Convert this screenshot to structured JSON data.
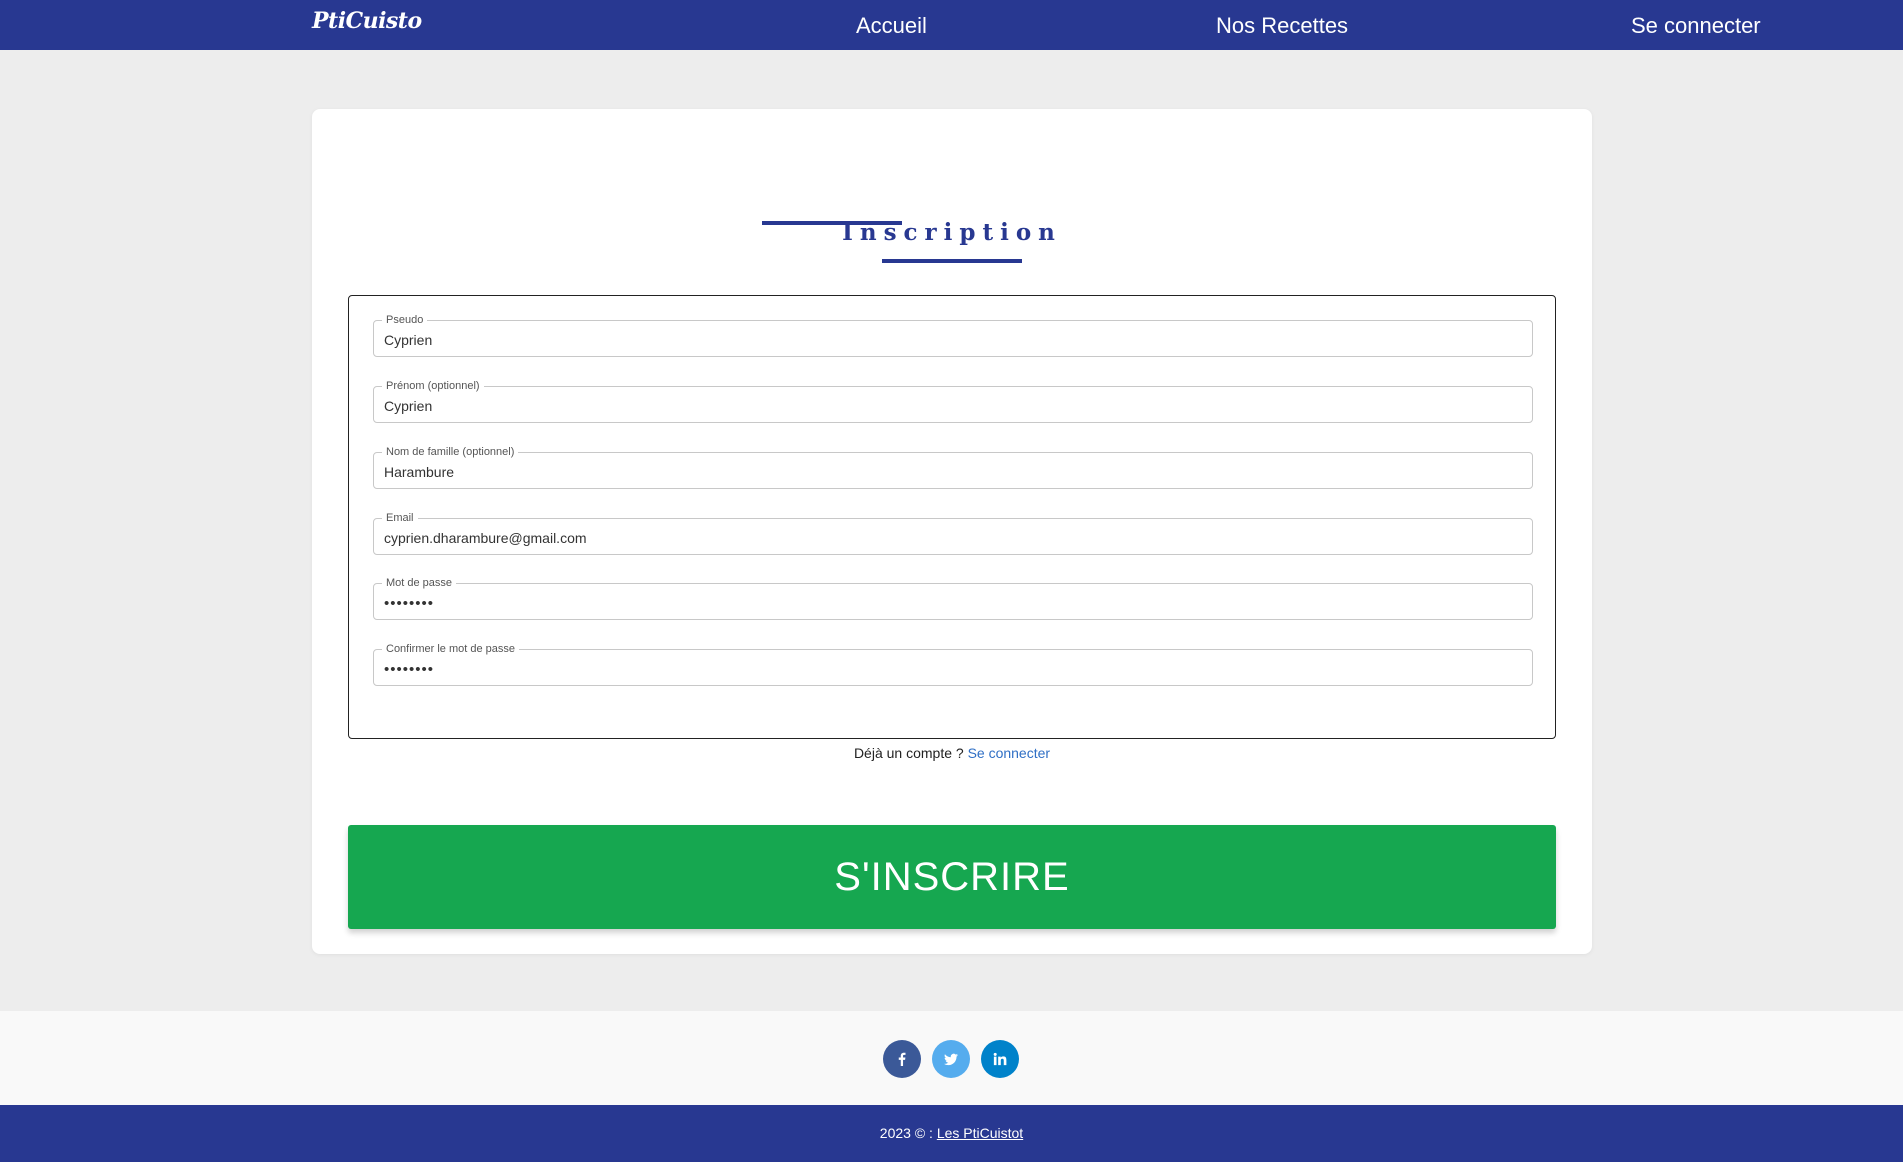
{
  "navbar": {
    "brand": "PtiCuisto",
    "links": [
      "Accueil",
      "Nos Recettes",
      "Se connecter"
    ]
  },
  "form": {
    "title": "Inscription",
    "fields": [
      {
        "label": "Pseudo",
        "value": "Cyprien"
      },
      {
        "label": "Prénom (optionnel)",
        "value": "Cyprien"
      },
      {
        "label": "Nom de famille (optionnel)",
        "value": "Harambure"
      },
      {
        "label": "Email",
        "value": "cyprien.dharambure@gmail.com"
      },
      {
        "label": "Mot de passe",
        "value": "••••••••"
      },
      {
        "label": "Confirmer le mot de passe",
        "value": "••••••••"
      }
    ],
    "login_prompt": "Déjà un compte ?",
    "login_link": "Se connecter",
    "submit_label": "S'INSCRIRE"
  },
  "social": {
    "icons": [
      "facebook-icon",
      "twitter-icon",
      "linkedin-icon"
    ]
  },
  "footer": {
    "copyright": "2023 © :",
    "link": "Les PtiCuistot"
  },
  "colors": {
    "primary": "#283891",
    "success": "#16a750",
    "facebook": "#3b5998",
    "twitter": "#55acee",
    "linkedin": "#0082ca",
    "link": "#2f6fc5"
  }
}
